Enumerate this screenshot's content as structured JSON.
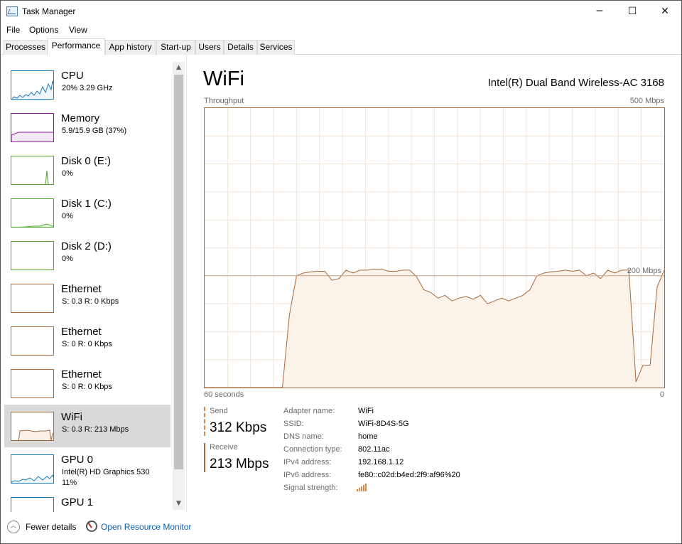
{
  "window": {
    "title": "Task Manager",
    "minimize": "─",
    "maximize": "☐",
    "close": "✕"
  },
  "menu": [
    "File",
    "Options",
    "View"
  ],
  "tabs": [
    "Processes",
    "Performance",
    "App history",
    "Start-up",
    "Users",
    "Details",
    "Services"
  ],
  "active_tab": "Performance",
  "sidebar": {
    "items": [
      {
        "name": "CPU",
        "sub": "20%  3.29 GHz",
        "sub2": "",
        "color": "#1a7bbd",
        "fill": "#f1f6fb"
      },
      {
        "name": "Memory",
        "sub": "5.9/15.9 GB (37%)",
        "sub2": "",
        "color": "#8b1a9b",
        "fill": "#f4e8f6"
      },
      {
        "name": "Disk 0 (E:)",
        "sub": "0%",
        "sub2": "",
        "color": "#4ea42a",
        "fill": "#eff7ea"
      },
      {
        "name": "Disk 1 (C:)",
        "sub": "0%",
        "sub2": "",
        "color": "#4ea42a",
        "fill": "#eff7ea"
      },
      {
        "name": "Disk 2 (D:)",
        "sub": "0%",
        "sub2": "",
        "color": "#4ea42a",
        "fill": "#eff7ea"
      },
      {
        "name": "Ethernet",
        "sub": "S: 0.3  R: 0 Kbps",
        "sub2": "",
        "color": "#a8683a",
        "fill": "#fbf1e8"
      },
      {
        "name": "Ethernet",
        "sub": "S: 0  R: 0 Kbps",
        "sub2": "",
        "color": "#a8683a",
        "fill": "#fbf1e8"
      },
      {
        "name": "Ethernet",
        "sub": "S: 0  R: 0 Kbps",
        "sub2": "",
        "color": "#a8683a",
        "fill": "#fbf1e8"
      },
      {
        "name": "WiFi",
        "sub": "S: 0.3  R: 213 Mbps",
        "sub2": "",
        "color": "#a8683a",
        "fill": "#fbf1e8"
      },
      {
        "name": "GPU 0",
        "sub": "Intel(R) HD Graphics 530",
        "sub2": "11%",
        "color": "#1a7bbd",
        "fill": "#f1f6fb"
      },
      {
        "name": "GPU 1",
        "sub": "",
        "sub2": "",
        "color": "#1a7bbd",
        "fill": "#f1f6fb"
      }
    ],
    "selected_index": 8,
    "scroll_up": "▲",
    "scroll_down": "▼"
  },
  "main": {
    "title": "WiFi",
    "adapter": "Intel(R) Dual Band Wireless-AC 3168",
    "chart_top_left": "Throughput",
    "chart_top_right": "500 Mbps",
    "chart_mid_label": "200 Mbps",
    "chart_bottom_left": "60 seconds",
    "chart_bottom_right": "0"
  },
  "chart_data": {
    "type": "area",
    "title": "Throughput",
    "xlabel": "60 seconds",
    "ylim": [
      0,
      500
    ],
    "x_range_seconds": [
      60,
      0
    ],
    "reference_line": 200,
    "line_color": "#a8683a",
    "fill_color": "#fbf1e8",
    "grid": true,
    "series": [
      {
        "values": [
          0,
          0,
          0,
          0,
          0,
          0,
          0,
          0,
          0,
          0,
          0,
          0,
          130,
          200,
          205,
          207,
          208,
          208,
          192,
          195,
          210,
          205,
          210,
          210,
          212,
          212,
          208,
          208,
          210,
          210,
          198,
          175,
          170,
          160,
          165,
          155,
          160,
          163,
          158,
          165,
          150,
          155,
          160,
          155,
          160,
          165,
          175,
          200,
          205,
          207,
          208,
          210,
          208,
          210,
          200,
          205,
          195,
          210,
          205,
          210,
          210,
          10,
          40,
          40,
          180,
          210
        ]
      }
    ]
  },
  "stats": {
    "send_label": "Send",
    "send_value": "312 Kbps",
    "send_color": "#d6884a",
    "receive_label": "Receive",
    "receive_value": "213 Mbps",
    "receive_color": "#a8683a"
  },
  "info": [
    {
      "key": "Adapter name:",
      "value": "WiFi"
    },
    {
      "key": "SSID:",
      "value": "WiFi-8D4S-5G"
    },
    {
      "key": "DNS name:",
      "value": "home"
    },
    {
      "key": "Connection type:",
      "value": "802.11ac"
    },
    {
      "key": "IPv4 address:",
      "value": "192.168.1.12"
    },
    {
      "key": "IPv6 address:",
      "value": "fe80::c02d:b4ed:2f9:af96%20"
    },
    {
      "key": "Signal strength:",
      "value": ""
    }
  ],
  "signal_bars": 5,
  "signal_bars_filled": 5,
  "footer": {
    "fewer_details": "Fewer details",
    "fewer_icon": "︿",
    "open_resource_monitor": "Open Resource Monitor"
  }
}
